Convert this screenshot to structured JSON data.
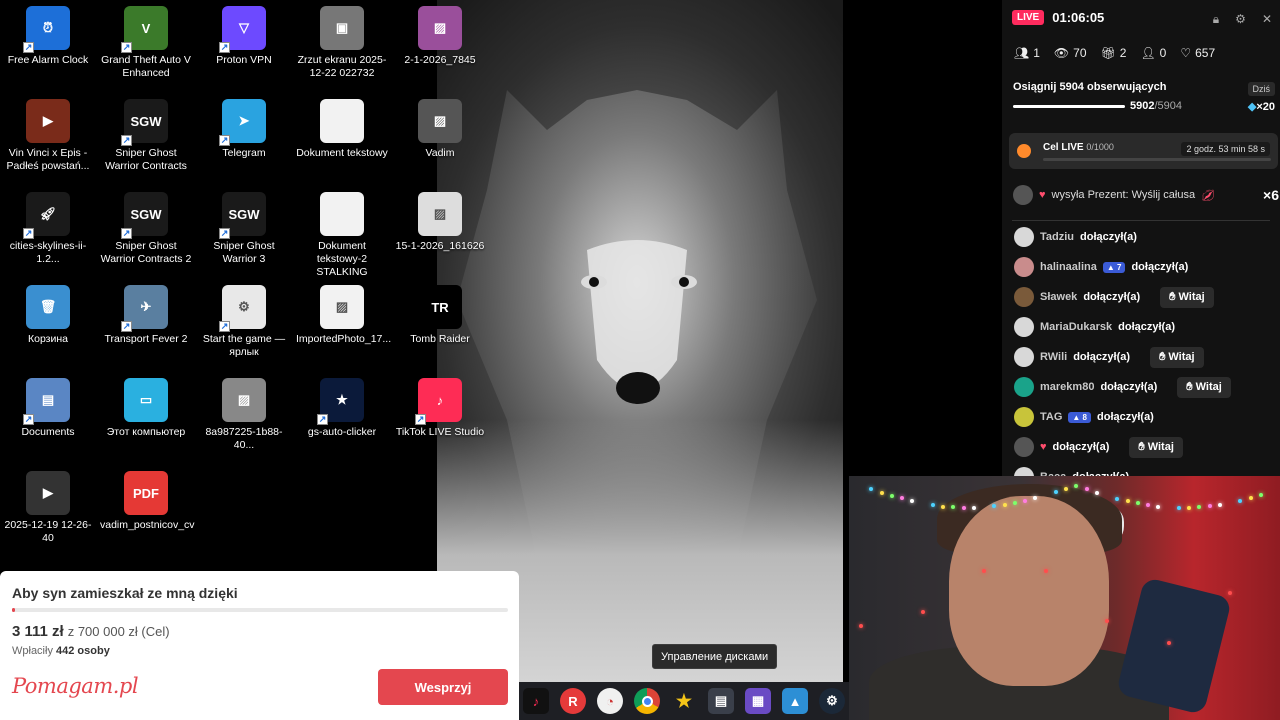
{
  "desktop": {
    "icons": [
      {
        "label": "Free Alarm Clock",
        "icon": "alarm-clock-icon",
        "color": "#1d6fd8"
      },
      {
        "label": "Grand Theft Auto V Enhanced",
        "icon": "gta-v-icon",
        "color": "#3b7a2a"
      },
      {
        "label": "Proton VPN",
        "icon": "proton-vpn-icon",
        "color": "#6d4aff"
      },
      {
        "label": "Zrzut ekranu 2025-12-22 022732",
        "icon": "screenshot-image-icon",
        "color": "#777777"
      },
      {
        "label": "2-1-2026_7845",
        "icon": "image-file-icon",
        "color": "#9a4f9b"
      },
      {
        "label": "Vin Vinci x Epis - Padłeś powstań...",
        "icon": "video-file-icon",
        "color": "#7a2b1a"
      },
      {
        "label": "Sniper Ghost Warrior Contracts",
        "icon": "sgw-contracts-icon",
        "color": "#1a1a1a"
      },
      {
        "label": "Telegram",
        "icon": "telegram-icon",
        "color": "#2aa3e0"
      },
      {
        "label": "Dokument tekstowy",
        "icon": "text-document-icon",
        "color": "#f2f2f2"
      },
      {
        "label": "Vadim",
        "icon": "image-file-icon",
        "color": "#555555"
      },
      {
        "label": "cities-skylines-ii-1.2...",
        "icon": "rocket-icon",
        "color": "#1a1a1a"
      },
      {
        "label": "Sniper Ghost Warrior Contracts 2",
        "icon": "sgw-contracts-2-icon",
        "color": "#1a1a1a"
      },
      {
        "label": "Sniper Ghost Warrior 3",
        "icon": "sgw3-icon",
        "color": "#1a1a1a"
      },
      {
        "label": "Dokument tekstowy-2 STALKING",
        "icon": "text-document-icon",
        "color": "#f2f2f2"
      },
      {
        "label": "15-1-2026_161626",
        "icon": "image-file-icon",
        "color": "#dddddd"
      },
      {
        "label": "Корзина",
        "icon": "recycle-bin-icon",
        "color": "#3a8fd0"
      },
      {
        "label": "Transport Fever 2",
        "icon": "transport-fever-icon",
        "color": "#5a7fa0"
      },
      {
        "label": "Start the game — ярлык",
        "icon": "gears-icon",
        "color": "#e8e8e8"
      },
      {
        "label": "ImportedPhoto_17...",
        "icon": "image-file-icon",
        "color": "#f2f2f2"
      },
      {
        "label": "Tomb Raider",
        "icon": "tomb-raider-icon",
        "color": "#000000"
      },
      {
        "label": "Documents",
        "icon": "folder-icon",
        "color": "#5a86c4"
      },
      {
        "label": "Этот компьютер",
        "icon": "computer-icon",
        "color": "#2ab0e0"
      },
      {
        "label": "8a987225-1b88-40...",
        "icon": "image-file-icon",
        "color": "#888888"
      },
      {
        "label": "gs-auto-clicker",
        "icon": "star-icon",
        "color": "#0b1a3a"
      },
      {
        "label": "TikTok LIVE Studio",
        "icon": "tiktok-icon",
        "color": "#fe2c55"
      },
      {
        "label": "2025-12-19 12-26-40",
        "icon": "video-file-icon",
        "color": "#333333"
      },
      {
        "label": "vadim_postnicov_cv",
        "icon": "pdf-icon",
        "color": "#e53935"
      }
    ]
  },
  "fundraiser": {
    "title": "Aby syn zamieszkał ze mną dzięki",
    "raised": "3 111 zł",
    "goal": "z 700 000 zł (Cel)",
    "donors_label": "Wpłaciły",
    "donors_count": "442 osoby",
    "logo": "Pomagam.pl",
    "button": "Wesprzyj",
    "progress": 0.0044,
    "accent": "#e4474f"
  },
  "taskbar": {
    "tooltip": "Управление дисками",
    "icons": [
      "tiktok-icon",
      "rockstar-icon",
      "chat-icon",
      "chrome-icon",
      "star-icon",
      "disk-management-icon",
      "app-icon",
      "photos-icon",
      "steam-icon"
    ]
  },
  "live_panel": {
    "badge": "LIVE",
    "time": "01:06:05",
    "stats": {
      "viewers_now": "1",
      "views": "70",
      "gifts": "2",
      "follows": "0",
      "likes": "657"
    },
    "goal": {
      "title": "Osiągnij 5904 obserwujących",
      "today": "Dziś",
      "current": "5902",
      "target": "/5904",
      "multiplier": "×20"
    },
    "cel": {
      "label": "Cel LIVE",
      "count": "0/1000",
      "timer": "2 godz. 53 min 58 s"
    },
    "gift_event": {
      "text": "wysyła Prezent: Wyślij całusa",
      "count": "×6"
    },
    "events": [
      {
        "name": "Tadziu",
        "action": "dołączył(a)",
        "level": "",
        "witaj": ""
      },
      {
        "name": "halinaalina",
        "action": "dołączył(a)",
        "level": "7",
        "witaj": ""
      },
      {
        "name": "Sławek",
        "action": "dołączył(a)",
        "level": "",
        "witaj": "Witaj"
      },
      {
        "name": "MariaDukarsk",
        "action": "dołączył(a)",
        "level": "",
        "witaj": ""
      },
      {
        "name": "RWili",
        "action": "dołączył(a)",
        "level": "",
        "witaj": "Witaj"
      },
      {
        "name": "marekm80",
        "action": "dołączył(a)",
        "level": "",
        "witaj": "Witaj"
      },
      {
        "name": "TAG",
        "action": "dołączył(a)",
        "level": "8",
        "witaj": ""
      },
      {
        "name": "",
        "action": "dołączył(a)",
        "level": "",
        "witaj": "Witaj"
      },
      {
        "name": "Baca",
        "action": "dołączył(a)",
        "level": "",
        "witaj": ""
      }
    ],
    "accent": "#ff2b5e"
  }
}
